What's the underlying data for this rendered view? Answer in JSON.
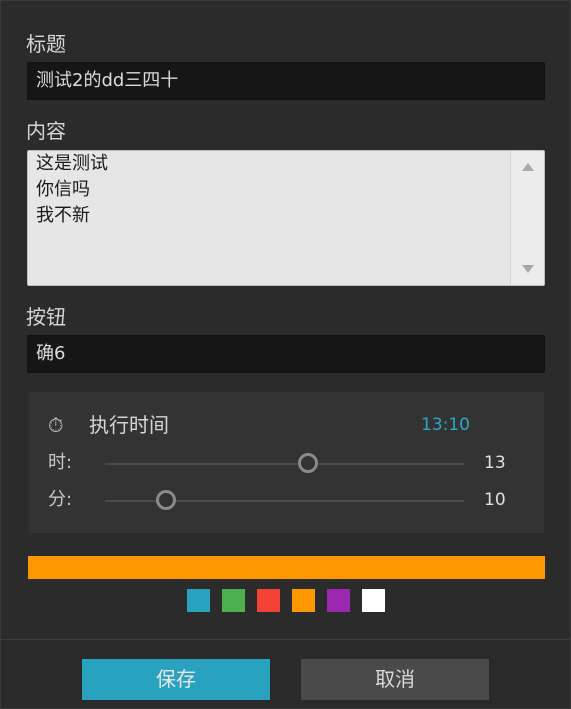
{
  "form": {
    "title_label": "标题",
    "title_value": "测试2的dd三四十",
    "content_label": "内容",
    "content_lines": [
      "这是测试",
      "你信吗",
      "我不新"
    ],
    "button_label": "按钮",
    "button_value": "确6"
  },
  "schedule": {
    "clock_icon": "stopwatch-icon",
    "clock_glyph": "⏱",
    "title": "执行时间",
    "time_display": "13:10",
    "hour_label": "时:",
    "hour_value": "13",
    "hour_range": [
      0,
      23
    ],
    "minute_label": "分:",
    "minute_value": "10",
    "minute_range": [
      0,
      59
    ]
  },
  "color": {
    "selected": "#ff9800",
    "swatches": [
      "#29a2c0",
      "#4caf50",
      "#f44336",
      "#ff9800",
      "#9c27b0",
      "#ffffff"
    ]
  },
  "footer": {
    "save_label": "保存",
    "cancel_label": "取消"
  }
}
